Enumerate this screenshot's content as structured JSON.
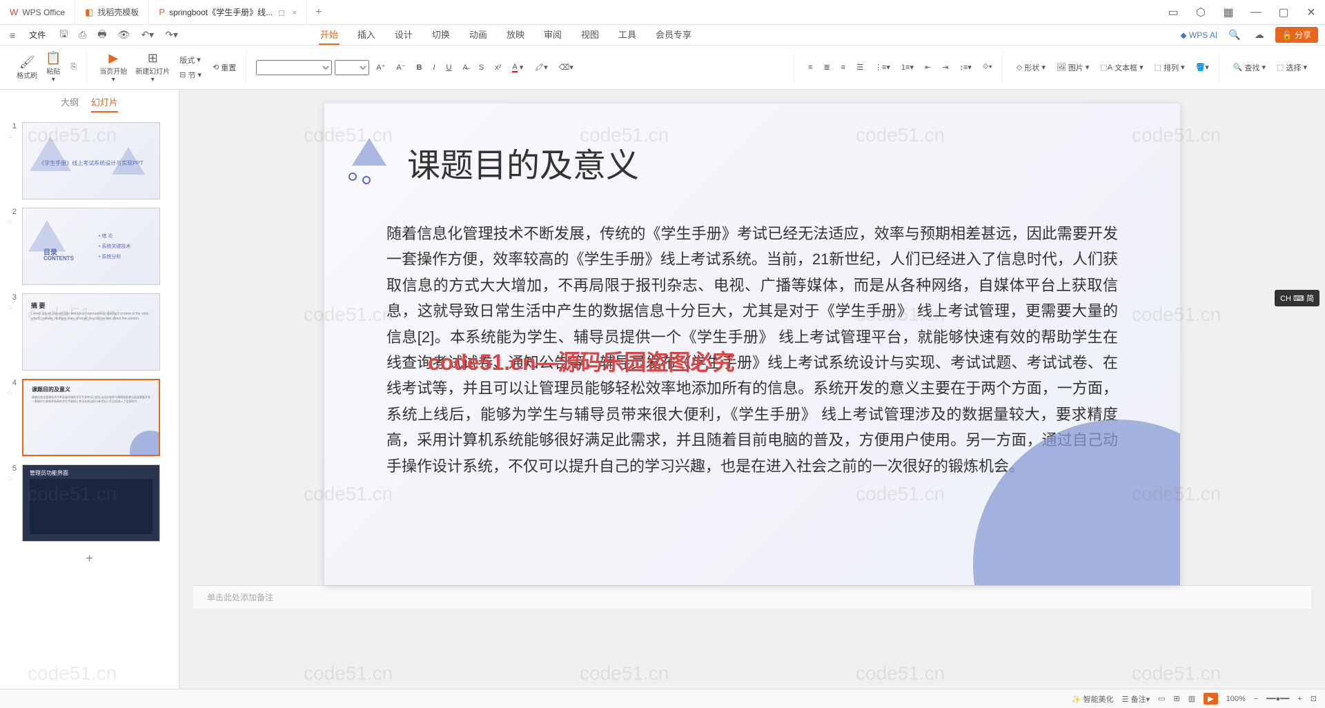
{
  "tabs": {
    "wps": "WPS Office",
    "template": "找稻壳模板",
    "doc": "springboot《学生手册》线...",
    "close": "×"
  },
  "menubar": {
    "hamburger": "≡",
    "file": "文件",
    "ribbonTabs": [
      "开始",
      "插入",
      "设计",
      "切换",
      "动画",
      "放映",
      "审阅",
      "视图",
      "工具",
      "会员专享"
    ],
    "wpsAi": "WPS AI",
    "share": "分享"
  },
  "ribbon": {
    "formatPainter": "格式刷",
    "paste": "粘贴",
    "currentPage": "当页开始",
    "newSlide": "新建幻灯片",
    "layout": "版式",
    "section": "节",
    "reset": "重置",
    "shape": "形状",
    "picture": "图片",
    "textbox": "文本框",
    "arrange": "排列",
    "find": "查找",
    "select": "选择"
  },
  "panelTabs": {
    "outline": "大纲",
    "slides": "幻灯片"
  },
  "slides": [
    {
      "num": "1",
      "title": "《学生手册》线上考试系统设计与实现PPT"
    },
    {
      "num": "2",
      "title": "目录",
      "sub": "CONTENTS",
      "items": [
        "绪 论",
        "系统关键技术",
        "系统分析"
      ]
    },
    {
      "num": "3",
      "title": "摘 要"
    },
    {
      "num": "4",
      "title": "课题目的及意义"
    },
    {
      "num": "5",
      "title": "管理员功能界面"
    }
  ],
  "currentSlide": {
    "title": "课题目的及意义",
    "body": "随着信息化管理技术不断发展，传统的《学生手册》考试已经无法适应，效率与预期相差甚远，因此需要开发一套操作方便，效率较高的《学生手册》线上考试系统。当前，21新世纪，人们已经进入了信息时代，人们获取信息的方式大大增加，不再局限于报刊杂志、电视、广播等媒体，而是从各种网络，自媒体平台上获取信息，这就导致日常生活中产生的数据信息十分巨大，尤其是对于《学生手册》 线上考试管理，更需要大量的信息[2]。本系统能为学生、辅导员提供一个《学生手册》 线上考试管理平台，就能够快速有效的帮助学生在线查询考试试卷、通知公告等，辅导员发布《学生手册》线上考试系统设计与实现、考试试题、考试试卷、在线考试等，并且可以让管理员能够轻松效率地添加所有的信息。系统开发的意义主要在于两个方面，一方面，系统上线后，能够为学生与辅导员带来很大便利，《学生手册》 线上考试管理涉及的数据量较大，要求精度高，采用计算机系统能够很好满足此需求，并且随着目前电脑的普及，方便用户使用。另一方面，通过自己动手操作设计系统，不仅可以提升自己的学习兴趣，也是在进入社会之前的一次很好的锻炼机会。"
  },
  "notes": "单击此处添加备注",
  "statusbar": {
    "smartBeautify": "智能美化",
    "zoom": "100%"
  },
  "langBadge": "CH ⌨ 简",
  "watermark": "code51.cn",
  "redWatermark": "code51.cn—源码乐园盗图必究"
}
